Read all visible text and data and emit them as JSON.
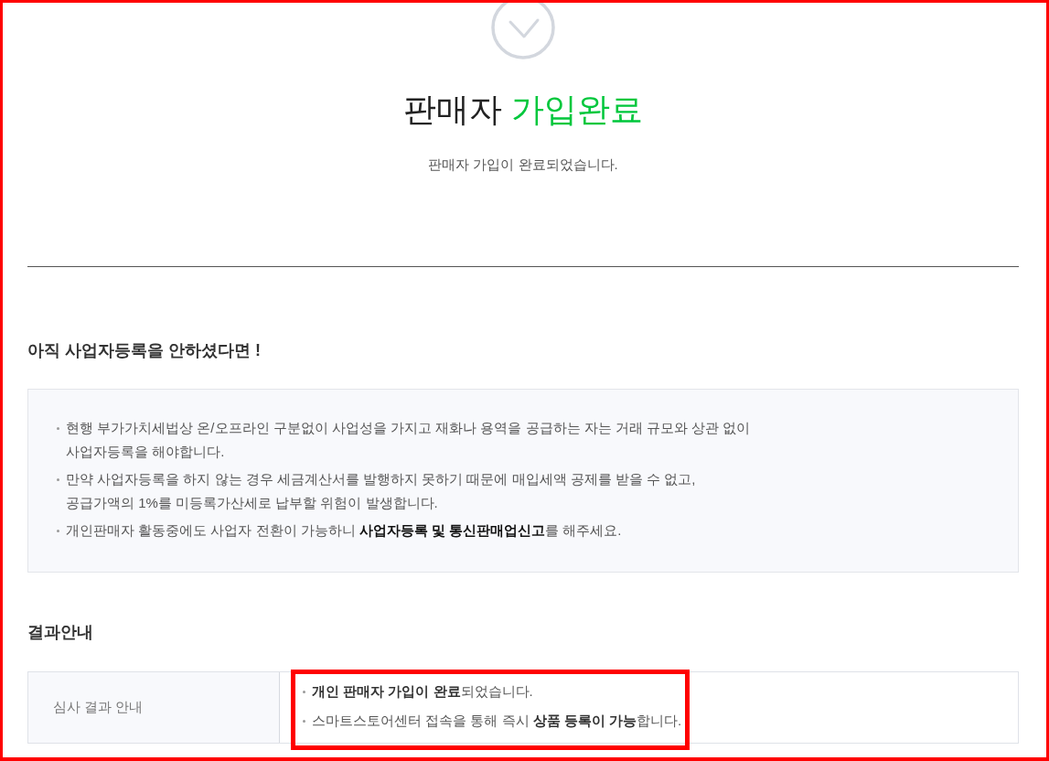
{
  "annotations": {
    "page_frame": true,
    "result_highlight": true
  },
  "header": {
    "title": "판매자",
    "title_highlight": "가입완료",
    "message": "판매자 가입이 완료되었습니다."
  },
  "notice": {
    "heading": "아직 사업자등록을 안하셨다면 !",
    "items": [
      "현행 부가가치세법상 온/오프라인 구분없이 사업성을 가지고 재화나 용역을 공급하는 자는 거래 규모와 상관 없이\n사업자등록을 해야합니다.",
      "만약 사업자등록을 하지 않는 경우 세금계산서를 발행하지 못하기 때문에 매입세액 공제를 받을 수 없고,\n공급가액의 1%를 미등록가산세로 납부할 위험이 발생합니다.",
      "개인판매자 활동중에도 사업자 전환이 가능하니 **사업자등록 및 통신판매업신고**를 해주세요."
    ]
  },
  "result": {
    "heading": "결과안내",
    "label": "심사 결과 안내",
    "messages": [
      "**개인 판매자 가입이 완료**되었습니다.",
      "스마트스토어센터 접속을 통해 즉시 **상품 등록이 가능**합니다."
    ]
  }
}
